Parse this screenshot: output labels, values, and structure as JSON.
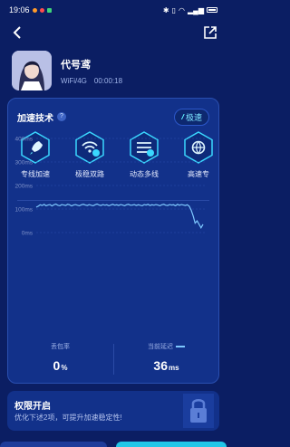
{
  "status_bar": {
    "time": "19:06",
    "icons": [
      "notification-dot-icon",
      "notification-dot-icon",
      "vpn-shield-icon"
    ],
    "right_icons": [
      "bluetooth-icon",
      "vibrate-icon",
      "wifi-icon",
      "signal-icon",
      "battery-icon"
    ]
  },
  "nav": {
    "back_icon": "chevron-left-icon",
    "share_icon": "external-link-icon"
  },
  "game": {
    "title": "代号鸢",
    "network": "WiFi/4G",
    "duration": "00:00:18"
  },
  "tech": {
    "title": "加速技术",
    "help": "?",
    "badge_icon": "bolt-icon",
    "badge_label": "极速",
    "items": [
      {
        "label": "专线加速",
        "icon": "rocket-icon"
      },
      {
        "label": "极稳双路",
        "icon": "wifi-dual-icon"
      },
      {
        "label": "动态多线",
        "icon": "multiline-icon"
      },
      {
        "label": "高速专",
        "icon": "globe-icon"
      }
    ]
  },
  "chart_data": {
    "type": "line",
    "title": "",
    "xlabel": "",
    "ylabel": "",
    "y_ticks": [
      "400ms",
      "300ms",
      "200ms",
      "100ms",
      "0ms"
    ],
    "ylim": [
      0,
      400
    ],
    "grid": true,
    "series": [
      {
        "values": [
          108,
          112,
          118,
          115,
          120,
          114,
          117,
          119,
          113,
          118,
          121,
          116,
          114,
          119,
          117,
          115,
          120,
          118,
          113,
          117,
          119,
          116,
          114,
          118,
          120,
          117,
          115,
          119,
          116,
          114,
          118,
          121,
          117,
          115,
          119,
          116,
          118,
          114,
          117,
          120,
          116,
          118,
          115,
          119,
          117,
          114,
          118,
          120,
          116,
          117,
          119,
          115,
          118,
          116,
          114,
          119,
          117,
          120,
          115,
          118,
          116,
          119,
          117,
          114,
          118,
          120,
          116,
          115,
          119,
          117,
          118,
          114,
          120,
          116,
          119,
          117,
          115,
          118,
          112,
          95,
          70,
          40,
          50,
          35,
          20,
          35
        ]
      }
    ]
  },
  "stats": {
    "loss_label": "丢包率",
    "loss_value": "0",
    "loss_unit": "%",
    "latency_label": "当前延迟",
    "latency_value": "36",
    "latency_unit": "ms"
  },
  "permission": {
    "title": "权限开启",
    "desc": "优化下述2项，可提升加速稳定性!",
    "icon": "lock-icon"
  },
  "colors": {
    "background": "#0b1e63",
    "panel": "#12318a",
    "accent": "#5ff2ff",
    "line": "#7ec8ff",
    "button": "#21c7e8"
  }
}
